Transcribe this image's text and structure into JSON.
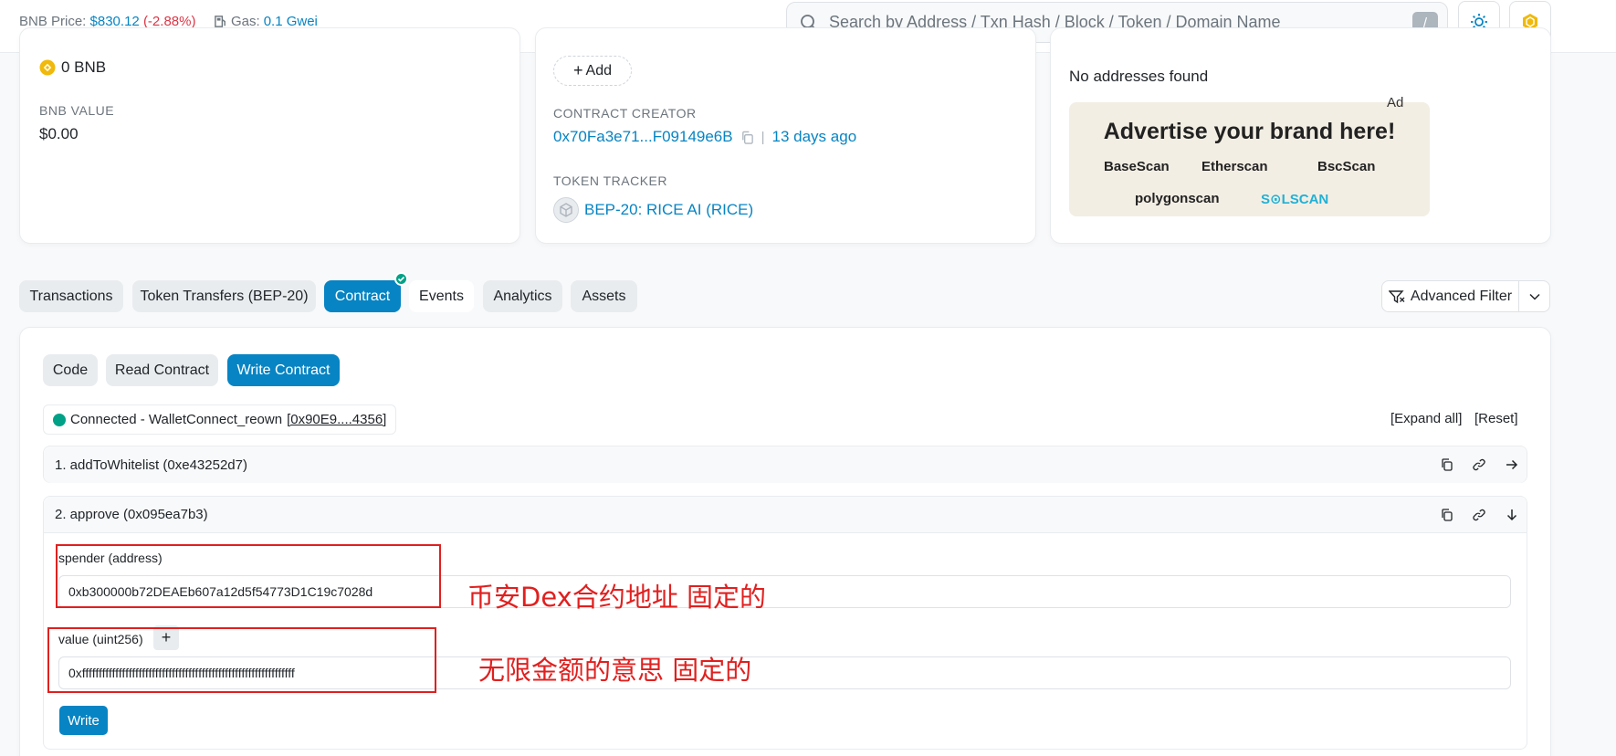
{
  "header": {
    "price_label": "BNB Price:",
    "price_value": "$830.12",
    "price_change": "(-2.88%)",
    "gas_label": "Gas:",
    "gas_value": "0.1 Gwei",
    "search_placeholder": "Search by Address / Txn Hash / Block / Token / Domain Name",
    "search_shortcut": "/"
  },
  "overview": {
    "bnb_balance": "0 BNB",
    "bnb_value_label": "BNB VALUE",
    "bnb_value": "$0.00"
  },
  "more_info": {
    "add_label": "Add",
    "creator_label": "CONTRACT CREATOR",
    "creator_address": "0x70Fa3e71...F09149e6B",
    "creator_sep": "|",
    "creator_age": "13 days ago",
    "tracker_label": "TOKEN TRACKER",
    "tracker_value": "BEP-20: RICE AI (RICE)"
  },
  "multichain": {
    "no_addresses": "No addresses found",
    "ad_tag": "Ad",
    "ad_title": "Advertise your brand here!",
    "ad_brands": [
      "BaseScan",
      "Etherscan",
      "BscScan",
      "polygonscan",
      "S⊙LSCAN"
    ]
  },
  "tabs": [
    "Transactions",
    "Token Transfers (BEP-20)",
    "Contract",
    "Events",
    "Analytics",
    "Assets"
  ],
  "filter_label": "Advanced Filter",
  "subtabs": [
    "Code",
    "Read Contract",
    "Write Contract"
  ],
  "connection": {
    "text": "Connected - WalletConnect_reown",
    "address": "[0x90E9....4356]"
  },
  "expand_all": "[Expand all]",
  "reset": "[Reset]",
  "functions": [
    {
      "title": "1. addToWhitelist (0xe43252d7)"
    },
    {
      "title": "2. approve (0x095ea7b3)"
    }
  ],
  "approve_form": {
    "spender_label": "spender (address)",
    "spender_value": "0xb300000b72DEAEb607a12d5f54773D1C19c7028d",
    "value_label": "value (uint256)",
    "value_value": "0xffffffffffffffffffffffffffffffffffffffffffffffffffffffffffffffff",
    "plus": "+",
    "write_label": "Write"
  },
  "annotations": {
    "spender_note": "币安Dex合约地址 固定的",
    "value_note": "无限金额的意思 固定的"
  }
}
